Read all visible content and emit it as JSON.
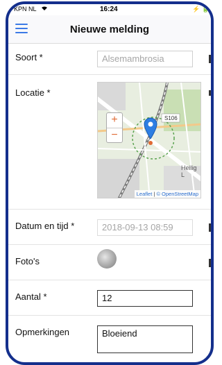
{
  "status": {
    "carrier": "KPN NL",
    "time": "16:24"
  },
  "header": {
    "title": "Nieuwe melding"
  },
  "form": {
    "soort_label": "Soort *",
    "soort_placeholder": "Alsemambrosia",
    "locatie_label": "Locatie *",
    "map": {
      "road_label": "S106",
      "area_label": "Heilig L",
      "zoom_in": "+",
      "zoom_out": "−",
      "attribution_leaflet": "Leaflet",
      "attribution_osm": "© OpenStreetMap"
    },
    "datum_label": "Datum en tijd *",
    "datum_placeholder": "2018-09-13 08:59",
    "foto_label": "Foto's",
    "aantal_label": "Aantal *",
    "aantal_value": "12",
    "opmerkingen_label": "Opmerkingen",
    "opmerkingen_value": "Bloeiend"
  },
  "colors": {
    "frame": "#142f8c",
    "accent": "#3b7ae6",
    "marker": "#2d7ee3"
  }
}
